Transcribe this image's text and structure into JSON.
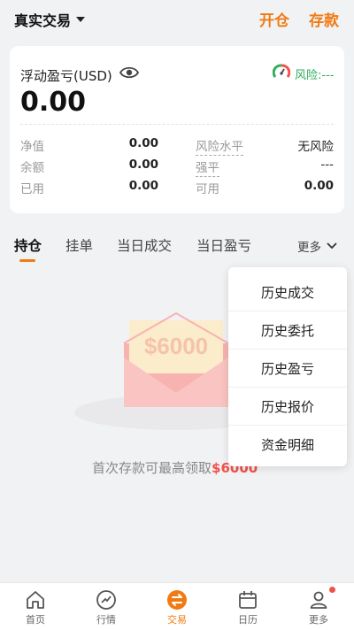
{
  "header": {
    "account_title": "真实交易",
    "open_position": "开仓",
    "deposit": "存款"
  },
  "card": {
    "floating_pl_label": "浮动盈亏(USD)",
    "floating_pl_value": "0.00",
    "risk_label": "风险:---",
    "rows": {
      "net_value_label": "净值",
      "net_value": "0.00",
      "balance_label": "余额",
      "balance": "0.00",
      "used_label": "已用",
      "used": "0.00",
      "risk_level_label": "风险水平",
      "risk_level": "无风险",
      "liquidation_label": "强平",
      "liquidation": "---",
      "available_label": "可用",
      "available": "0.00"
    }
  },
  "tabs": {
    "positions": "持仓",
    "orders": "挂单",
    "today_deals": "当日成交",
    "today_pl": "当日盈亏",
    "more": "更多"
  },
  "dropdown": {
    "items": [
      "历史成交",
      "历史委托",
      "历史盈亏",
      "历史报价",
      "资金明细"
    ]
  },
  "promo": {
    "envelope_amount": "$6000",
    "text_prefix": "首次存款可最高领取",
    "text_amount": "$6000"
  },
  "bottom_nav": {
    "items": [
      "首页",
      "行情",
      "交易",
      "日历",
      "更多"
    ],
    "active": "交易"
  },
  "colors": {
    "accent": "#f07b14",
    "risk_green": "#2fae5b",
    "promo_red": "#f2514a"
  }
}
